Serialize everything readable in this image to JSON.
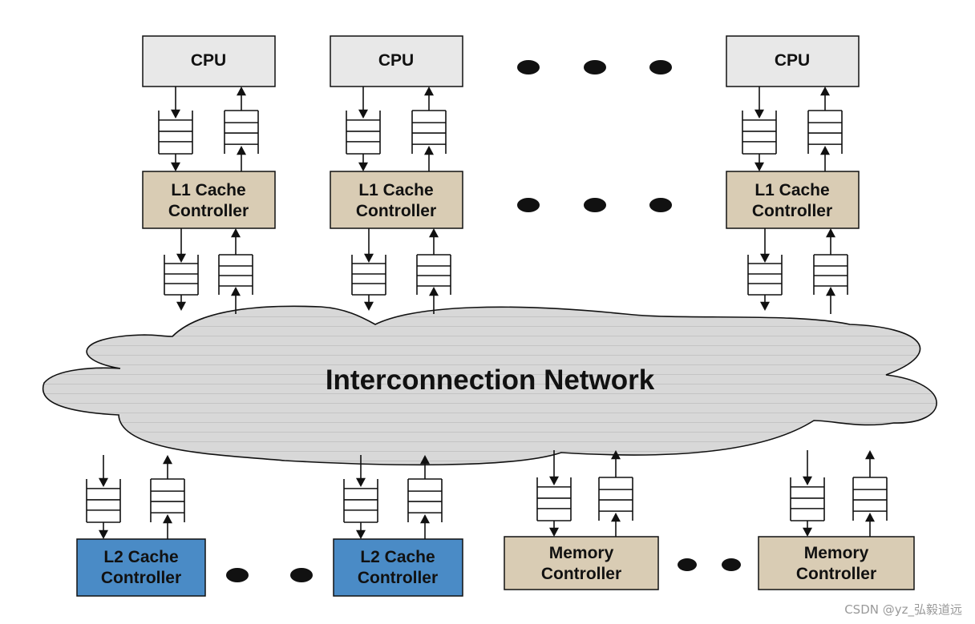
{
  "colors": {
    "cpu_fill": "#e8e8e8",
    "controller_fill": "#d9ccb4",
    "l2_fill": "#4a8bc6",
    "network_fill": "#d8d8d8",
    "stroke": "#111111",
    "dot": "#111111"
  },
  "cpus": [
    {
      "label": "CPU"
    },
    {
      "label": "CPU"
    },
    {
      "label": "CPU"
    }
  ],
  "l1_controllers": [
    {
      "line1": "L1 Cache",
      "line2": "Controller"
    },
    {
      "line1": "L1 Cache",
      "line2": "Controller"
    },
    {
      "line1": "L1 Cache",
      "line2": "Controller"
    }
  ],
  "network": {
    "label": "Interconnection Network"
  },
  "l2_controllers": [
    {
      "line1": "L2 Cache",
      "line2": "Controller"
    },
    {
      "line1": "L2 Cache",
      "line2": "Controller"
    }
  ],
  "memory_controllers": [
    {
      "line1": "Memory",
      "line2": "Controller"
    },
    {
      "line1": "Memory",
      "line2": "Controller"
    }
  ],
  "watermark": "CSDN @yz_弘毅道远"
}
